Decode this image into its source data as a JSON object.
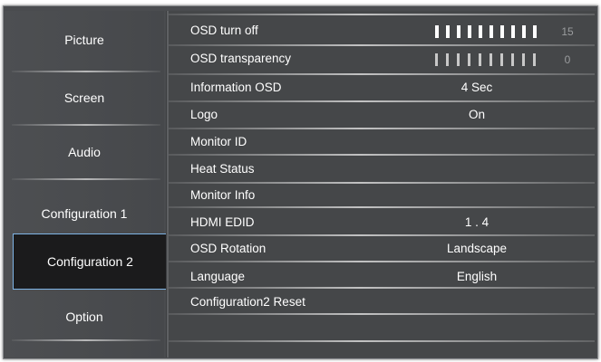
{
  "nav": {
    "items": [
      {
        "label": "Picture"
      },
      {
        "label": "Screen"
      },
      {
        "label": "Audio"
      },
      {
        "label": "Configuration 1"
      },
      {
        "label": "Configuration 2",
        "selected": true
      },
      {
        "label": "Option"
      }
    ]
  },
  "menu": {
    "rows": [
      {
        "label": "OSD turn off",
        "slider": {
          "value": "15",
          "level": 1.0
        }
      },
      {
        "label": "OSD transparency",
        "slider": {
          "value": "0",
          "level": 0.0
        }
      },
      {
        "label": "Information OSD",
        "value": "4 Sec"
      },
      {
        "label": "Logo",
        "value": "On"
      },
      {
        "label": "Monitor ID",
        "value": ""
      },
      {
        "label": "Heat Status",
        "value": ""
      },
      {
        "label": "Monitor Info",
        "value": ""
      },
      {
        "label": "HDMI EDID",
        "value": "1 . 4"
      },
      {
        "label": "OSD Rotation",
        "value": "Landscape"
      },
      {
        "label": "Language",
        "value": "English"
      },
      {
        "label": "Configuration2 Reset",
        "value": ""
      }
    ]
  },
  "colors": {
    "panel_bg": "#4a4c4f",
    "selected_bg": "#1b1b1c",
    "selected_border": "#7fb5e6",
    "text": "#ffffff"
  }
}
